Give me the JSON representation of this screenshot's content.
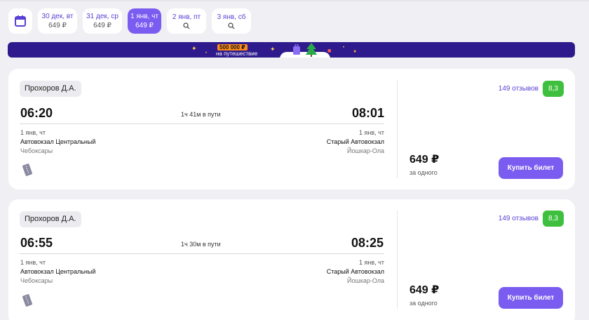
{
  "dates": [
    {
      "day": "30 дек, вт",
      "price": "649 ₽",
      "active": false
    },
    {
      "day": "31 дек, ср",
      "price": "649 ₽",
      "active": false
    },
    {
      "day": "1 янв, чт",
      "price": "649 ₽",
      "active": true
    },
    {
      "day": "2 янв, пт",
      "icon": "search-icon",
      "active": false
    },
    {
      "day": "3 янв, сб",
      "icon": "search-icon",
      "active": false
    }
  ],
  "banner": {
    "amount": "500 000 ₽",
    "text": "на путешествие"
  },
  "trips": [
    {
      "carrier": "Прохоров Д.А.",
      "depart_time": "06:20",
      "arrive_time": "08:01",
      "duration": "1ч 41м в пути",
      "depart_date": "1 янв, чт",
      "arrive_date": "1 янв, чт",
      "depart_station": "Автовокзал Центральный",
      "arrive_station": "Старый Автовокзал",
      "depart_city": "Чебоксары",
      "arrive_city": "Йошкар-Ола",
      "reviews": "149 отзывов",
      "rating": "8,3",
      "price": "649 ₽",
      "price_note": "за одного",
      "buy_label": "Купить билет"
    },
    {
      "carrier": "Прохоров Д.А.",
      "depart_time": "06:55",
      "arrive_time": "08:25",
      "duration": "1ч 30м в пути",
      "depart_date": "1 янв, чт",
      "arrive_date": "1 янв, чт",
      "depart_station": "Автовокзал Центральный",
      "arrive_station": "Старый Автовокзал",
      "depart_city": "Чебоксары",
      "arrive_city": "Йошкар-Ола",
      "reviews": "149 отзывов",
      "rating": "8,3",
      "price": "649 ₽",
      "price_note": "за одного",
      "buy_label": "Купить билет"
    }
  ],
  "colors": {
    "accent": "#7b5cf0",
    "banner": "#2e1a8c",
    "rating": "#3ec03e"
  }
}
